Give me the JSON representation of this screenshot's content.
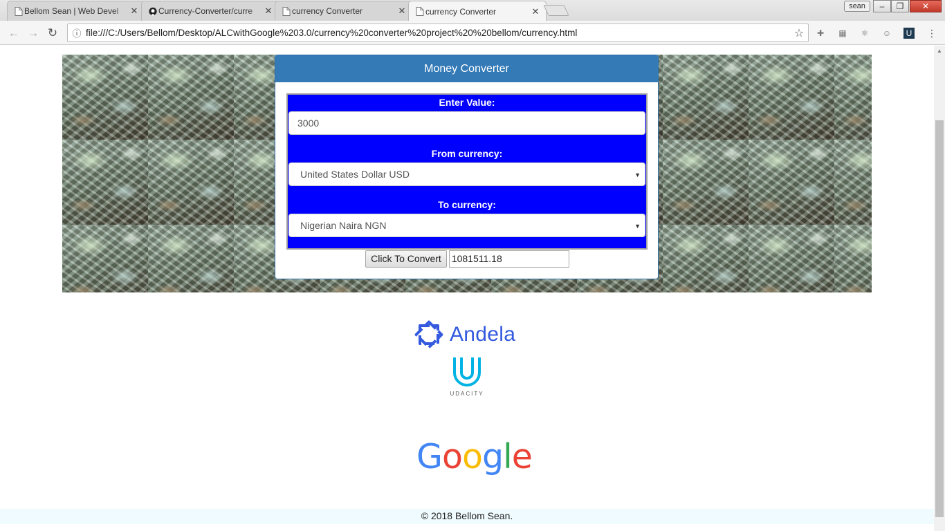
{
  "browser": {
    "tabs": [
      {
        "title": "Bellom Sean | Web Devel",
        "icon": "page-icon"
      },
      {
        "title": "Currency-Converter/curre",
        "icon": "github-icon"
      },
      {
        "title": "currency Converter",
        "icon": "page-icon"
      },
      {
        "title": "currency Converter",
        "icon": "page-icon",
        "active": true
      }
    ],
    "user": "sean",
    "url": "file:///C:/Users/Bellom/Desktop/ALCwithGoogle%203.0/currency%20converter%20project%20%20bellom/currency.html"
  },
  "converter": {
    "title": "Money Converter",
    "value_label": "Enter Value:",
    "value": "3000",
    "from_label": "From currency:",
    "from_value": "United States Dollar USD",
    "to_label": "To currency:",
    "to_value": "Nigerian Naira NGN",
    "button_label": "Click To Convert",
    "result": "1081511.18"
  },
  "sponsors": {
    "andela": "Andela",
    "udacity": "UDACITY",
    "google": "Google"
  },
  "footer": "© 2018 Bellom Sean.",
  "colors": {
    "header_blue": "#337ab7",
    "form_blue": "#0000ff",
    "andela_blue": "#3359df",
    "udacity_blue": "#02b3e4"
  }
}
